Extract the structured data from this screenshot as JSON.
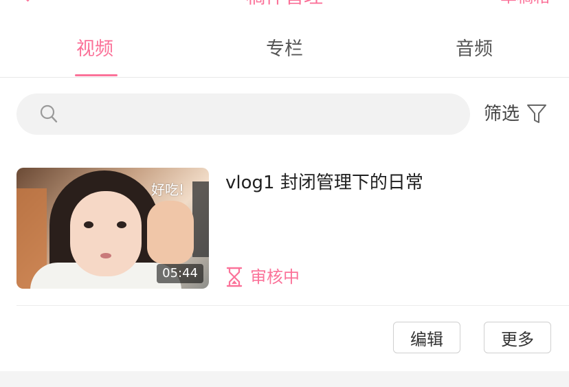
{
  "header": {
    "title": "稿件管理",
    "right_action": "草稿箱"
  },
  "tabs": [
    {
      "label": "视频",
      "active": true
    },
    {
      "label": "专栏",
      "active": false
    },
    {
      "label": "音频",
      "active": false
    }
  ],
  "search": {
    "placeholder": "",
    "value": ""
  },
  "filter": {
    "label": "筛选",
    "icon": "filter-funnel-icon"
  },
  "items": [
    {
      "title": "vlog1 封闭管理下的日常",
      "thumbnail_caption": "好吃!",
      "duration": "05:44",
      "status": "审核中",
      "status_icon": "hourglass-icon"
    }
  ],
  "actions": {
    "edit_label": "编辑",
    "more_label": "更多"
  },
  "colors": {
    "accent": "#fb7299",
    "search_bg": "#f2f2f2",
    "divider": "#e7e7e7"
  }
}
